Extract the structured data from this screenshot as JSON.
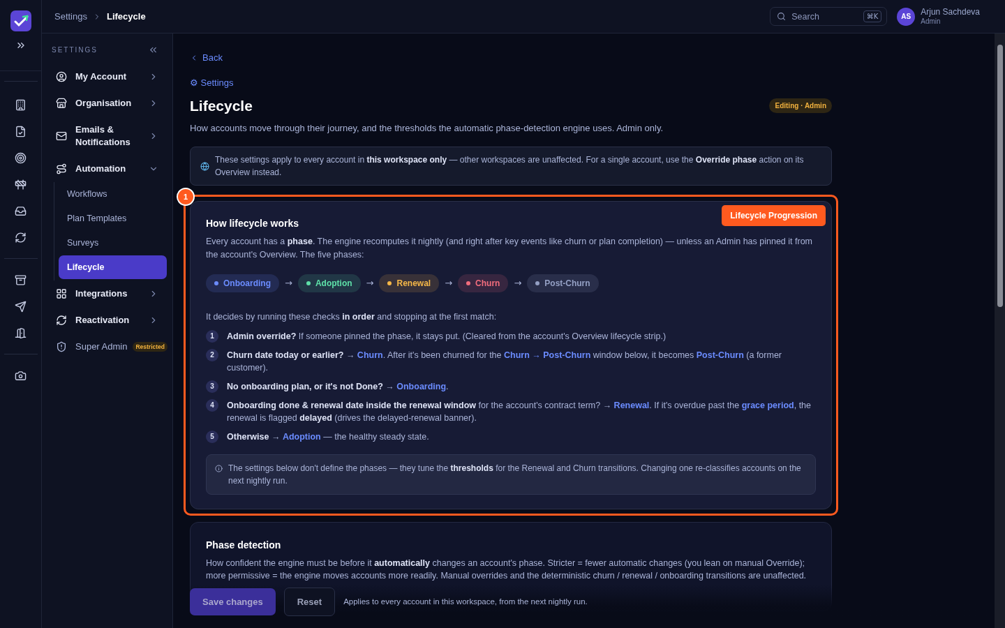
{
  "breadcrumb": [
    {
      "label": "Settings",
      "selected": false
    },
    {
      "label": "Lifecycle",
      "selected": true
    }
  ],
  "search": {
    "placeholder": "Search",
    "shortcut": "⌘K"
  },
  "user": {
    "initials": "AS",
    "name": "Arjun Sachdeva",
    "role": "Admin"
  },
  "sidebar": {
    "heading": "SETTINGS",
    "items": [
      {
        "label": "My Account",
        "kind": "group",
        "expanded": false
      },
      {
        "label": "Organisation",
        "kind": "group",
        "expanded": false
      },
      {
        "label": "Emails & Notifications",
        "kind": "group",
        "expanded": false
      },
      {
        "label": "Automation",
        "kind": "group",
        "expanded": true,
        "children": [
          {
            "label": "Workflows",
            "selected": false
          },
          {
            "label": "Plan Templates",
            "selected": false
          },
          {
            "label": "Surveys",
            "selected": false
          },
          {
            "label": "Lifecycle",
            "selected": true
          }
        ]
      },
      {
        "label": "Integrations",
        "kind": "group",
        "expanded": false
      },
      {
        "label": "Reactivation",
        "kind": "group",
        "expanded": false
      },
      {
        "label": "Super Admin",
        "kind": "restricted",
        "badge": "Restricted"
      }
    ]
  },
  "back": "Back",
  "parent_link": "⚙ Settings",
  "title": "Lifecycle",
  "badge": "Editing · Admin",
  "subtitle": "How accounts move through their journey, and the thresholds the automatic phase-detection engine uses. Admin only.",
  "notice": "These settings apply to every account in **this workspace only** — other workspaces are unaffected. For a single account, use the **Override phase** action on its Overview instead.",
  "annotation": {
    "number": "1",
    "label": "Lifecycle Progression"
  },
  "how_card": {
    "title": "How lifecycle works",
    "intro": "Every account has a **phase**. The engine recomputes it nightly (and right after key events like churn or plan completion) — unless an Admin has pinned it from the account's Overview. The five phases:",
    "phases": [
      {
        "label": "Onboarding",
        "color": "#6b8cff"
      },
      {
        "label": "Adoption",
        "color": "#5ee0a8"
      },
      {
        "label": "Renewal",
        "color": "#f5b748"
      },
      {
        "label": "Churn",
        "color": "#f26d7d"
      },
      {
        "label": "Post-Churn",
        "color": "#94a0c4"
      }
    ],
    "arrow": "→",
    "checks_intro": "It decides by running these checks **in order** and stopping at the first match:",
    "checks": [
      {
        "number": "1",
        "parts": [
          {
            "kind": "bold",
            "text": "Admin override?"
          },
          {
            "kind": "plain",
            "text": " If someone pinned the phase, it stays put. (Cleared from the account's Overview lifecycle strip.)"
          }
        ]
      },
      {
        "number": "2",
        "parts": [
          {
            "kind": "bold",
            "text": "Churn date today or earlier?"
          },
          {
            "kind": "plain",
            "text": " → "
          },
          {
            "kind": "accent",
            "text": "Churn"
          },
          {
            "kind": "plain",
            "text": ". After it's been churned for the "
          },
          {
            "kind": "accent",
            "text": "Churn → Post-Churn"
          },
          {
            "kind": "plain",
            "text": " window below, it becomes "
          },
          {
            "kind": "accent",
            "text": "Post-Churn"
          },
          {
            "kind": "plain",
            "text": " (a former customer)."
          }
        ]
      },
      {
        "number": "3",
        "parts": [
          {
            "kind": "bold",
            "text": "No onboarding plan, or it's not Done?"
          },
          {
            "kind": "plain",
            "text": " → "
          },
          {
            "kind": "accent",
            "text": "Onboarding"
          },
          {
            "kind": "plain",
            "text": "."
          }
        ]
      },
      {
        "number": "4",
        "parts": [
          {
            "kind": "bold",
            "text": "Onboarding done & renewal date inside the renewal window"
          },
          {
            "kind": "plain",
            "text": " for the account's contract term? → "
          },
          {
            "kind": "accent",
            "text": "Renewal"
          },
          {
            "kind": "plain",
            "text": ". If it's overdue past the "
          },
          {
            "kind": "accent",
            "text": "grace period"
          },
          {
            "kind": "plain",
            "text": ", the renewal is flagged "
          },
          {
            "kind": "bold",
            "text": "delayed"
          },
          {
            "kind": "plain",
            "text": " (drives the delayed-renewal banner)."
          }
        ]
      },
      {
        "number": "5",
        "parts": [
          {
            "kind": "bold",
            "text": "Otherwise"
          },
          {
            "kind": "plain",
            "text": " → "
          },
          {
            "kind": "accent",
            "text": "Adoption"
          },
          {
            "kind": "plain",
            "text": " — the healthy steady state."
          }
        ]
      }
    ],
    "note": "The settings below don't define the phases — they tune the **thresholds** for the Renewal and Churn transitions. Changing one re-classifies accounts on the next nightly run."
  },
  "detection_card": {
    "title": "Phase detection",
    "text": "How confident the engine must be before it **automatically** changes an account's phase. Stricter = fewer automatic changes (you lean on manual Override); more permissive = the engine moves accounts more readily. Manual overrides and the deterministic churn / renewal / onboarding transitions are unaffected."
  },
  "footer": {
    "save": "Save changes",
    "reset": "Reset",
    "hint": "Applies to every account in this workspace, from the next nightly run."
  }
}
